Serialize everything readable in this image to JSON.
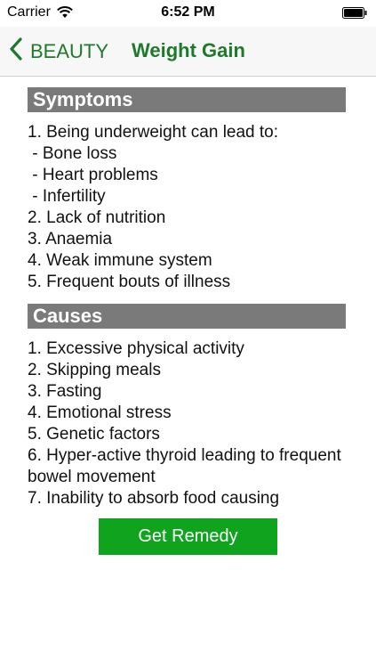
{
  "status_bar": {
    "carrier": "Carrier",
    "time": "6:52 PM",
    "wifi_icon": "wifi-icon",
    "battery_icon": "battery-icon"
  },
  "nav": {
    "back_label": "BEAUTY",
    "back_icon": "chevron-left-icon",
    "title": "Weight Gain",
    "accent_color": "#1e7a2a"
  },
  "sections": [
    {
      "header": "Symptoms",
      "items": [
        "1. Being underweight can lead to:",
        " - Bone loss",
        " - Heart problems",
        " - Infertility",
        "2. Lack of nutrition",
        "3. Anaemia",
        "4. Weak immune system",
        "5. Frequent bouts of illness"
      ]
    },
    {
      "header": "Causes",
      "items": [
        "1. Excessive physical activity",
        "2. Skipping meals",
        "3. Fasting",
        "4. Emotional stress",
        "5. Genetic factors",
        "6. Hyper-active thyroid leading to frequent bowel movement",
        "7. Inability to absorb food causing"
      ]
    }
  ],
  "button": {
    "label": "Get Remedy",
    "color": "#0fa31e"
  }
}
